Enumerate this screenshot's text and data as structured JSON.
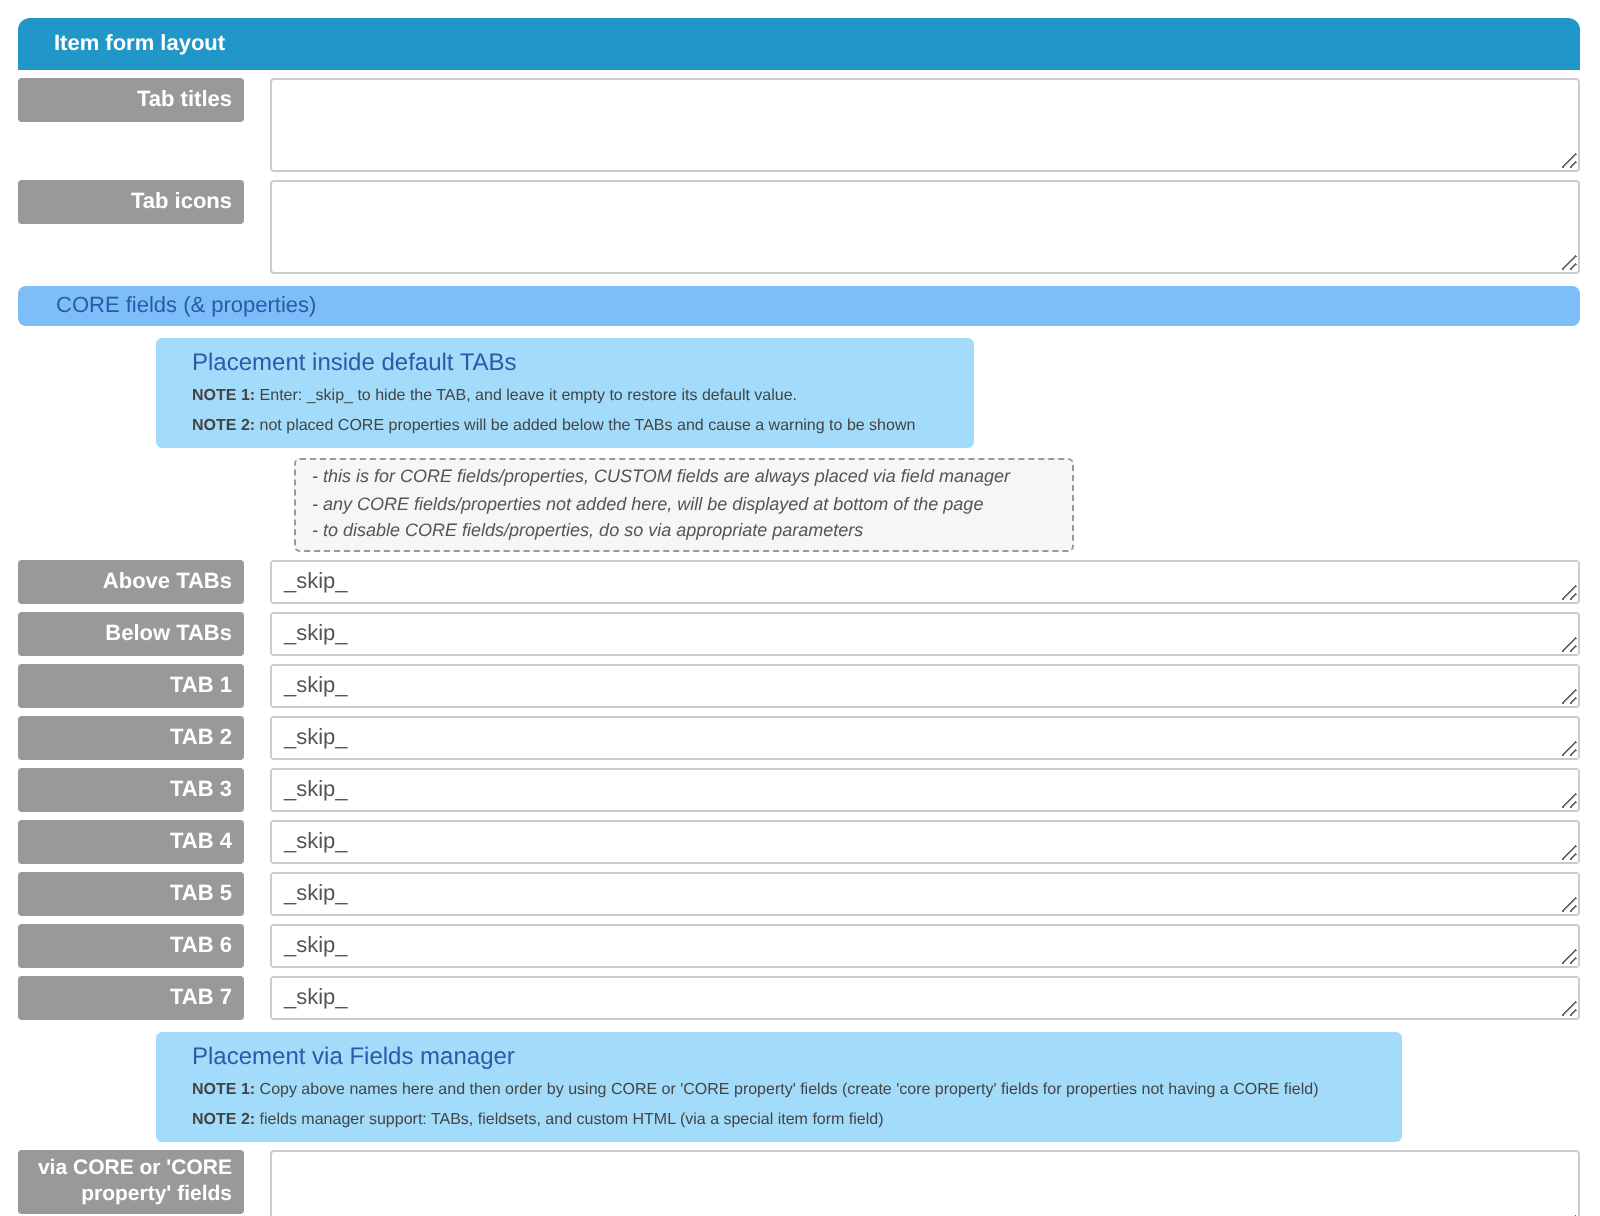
{
  "header": {
    "title": "Item form layout"
  },
  "top_fields": [
    {
      "label": "Tab titles"
    },
    {
      "label": "Tab icons"
    }
  ],
  "section": {
    "title": "CORE fields (& properties)"
  },
  "info_default": {
    "title": "Placement inside default TABs",
    "notes": [
      "**NOTE 1:** Enter: _skip_ to hide the TAB, and leave it empty to restore its default value.",
      "**NOTE 2:** not placed CORE properties will be added below the TABs and cause a warning to be shown"
    ]
  },
  "hints": [
    "- this is for CORE fields/properties, CUSTOM fields are always placed via field manager",
    "- any CORE fields/properties not added here, will be displayed at bottom of the page",
    "- to disable CORE fields/properties, do so via appropriate parameters"
  ],
  "tab_fields": [
    {
      "label": "Above TABs",
      "value": "_skip_"
    },
    {
      "label": "Below TABs",
      "value": "_skip_"
    },
    {
      "label": "TAB 1",
      "value": "_skip_"
    },
    {
      "label": "TAB 2",
      "value": "_skip_"
    },
    {
      "label": "TAB 3",
      "value": "_skip_"
    },
    {
      "label": "TAB 4",
      "value": "_skip_"
    },
    {
      "label": "TAB 5",
      "value": "_skip_"
    },
    {
      "label": "TAB 6",
      "value": "_skip_"
    },
    {
      "label": "TAB 7",
      "value": "_skip_"
    }
  ],
  "info_manager": {
    "title": "Placement via Fields manager",
    "notes": [
      "**NOTE 1:** Copy above names here and then order by using CORE or 'CORE property' fields (create 'core property' fields for properties not having a CORE field)",
      "**NOTE 2:** fields manager support: TABs, fieldsets, and custom HTML (via a special item form field)"
    ]
  },
  "bottom_field": {
    "label": "via CORE or 'CORE property' fields"
  }
}
